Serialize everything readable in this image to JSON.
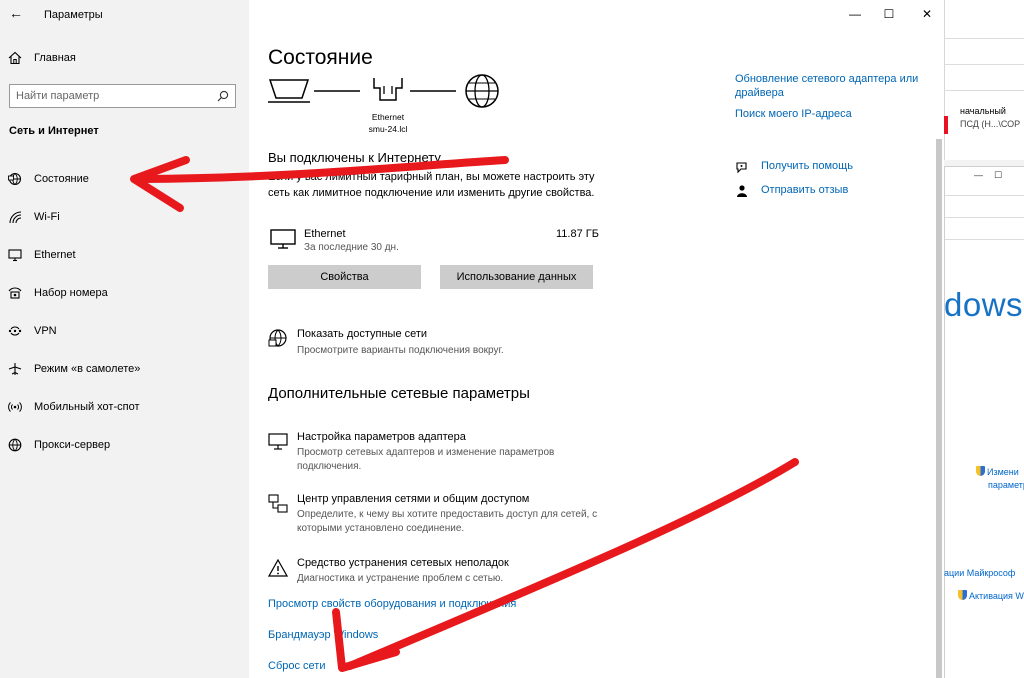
{
  "window": {
    "title": "Параметры",
    "back_glyph": "←",
    "controls": {
      "minimize": "—",
      "maximize": "☐",
      "close": "✕"
    }
  },
  "sidebar": {
    "home_label": "Главная",
    "search_placeholder": "Найти параметр",
    "section_label": "Сеть и Интернет",
    "items": [
      {
        "label": "Состояние",
        "icon": "status-icon"
      },
      {
        "label": "Wi-Fi",
        "icon": "wifi-icon"
      },
      {
        "label": "Ethernet",
        "icon": "ethernet-icon"
      },
      {
        "label": "Набор номера",
        "icon": "dialup-icon"
      },
      {
        "label": "VPN",
        "icon": "vpn-icon"
      },
      {
        "label": "Режим «в самолете»",
        "icon": "airplane-icon"
      },
      {
        "label": "Мобильный хот-спот",
        "icon": "hotspot-icon"
      },
      {
        "label": "Прокси-сервер",
        "icon": "globe-icon"
      }
    ]
  },
  "main": {
    "title": "Состояние",
    "diagram": {
      "adapter_name": "Ethernet",
      "host_name": "smu-24.lcl"
    },
    "connected_title": "Вы подключены к Интернету",
    "connected_desc": "Если у вас лимитный тарифный план, вы можете настроить эту сеть как лимитное подключение или изменить другие свойства.",
    "ethernet": {
      "name": "Ethernet",
      "period": "За последние 30 дн.",
      "usage": "11.87 ГБ"
    },
    "buttons": {
      "properties": "Свойства",
      "data_usage": "Использование данных"
    },
    "show_networks": {
      "title": "Показать доступные сети",
      "desc": "Просмотрите варианты подключения вокруг."
    },
    "advanced_title": "Дополнительные сетевые параметры",
    "advanced": [
      {
        "title": "Настройка параметров адаптера",
        "desc": "Просмотр сетевых адаптеров и изменение параметров подключения.",
        "icon": "adapter-icon"
      },
      {
        "title": "Центр управления сетями и общим доступом",
        "desc": "Определите, к чему вы хотите предоставить доступ для сетей, с которыми установлено соединение.",
        "icon": "network-center-icon"
      },
      {
        "title": "Средство устранения сетевых неполадок",
        "desc": "Диагностика и устранение проблем с сетью.",
        "icon": "warning-icon"
      }
    ],
    "links": {
      "hardware": "Просмотр свойств оборудования и подключения",
      "firewall": "Брандмауэр Windows",
      "reset": "Сброс сети"
    }
  },
  "right_panel": {
    "update_adapter": "Обновление сетевого адаптера или драйвера",
    "update_adapter_line1": "Обновление сетевого адаптера или",
    "update_adapter_line2": "драйвера",
    "find_ip": "Поиск моего IP-адреса",
    "get_help": "Получить помощь",
    "feedback": "Отправить отзыв"
  },
  "background_window": {
    "label1": "начальный",
    "label2": "ПСД (Н...\\СОР",
    "windows_text": "dows",
    "link1_line1": "Измени",
    "link1_line2": "параметры",
    "link2": "ации Майкрософ",
    "link3": "Активация Wi"
  },
  "colors": {
    "accent": "#0066b4",
    "annotation": "#e8191c",
    "sidebar_bg": "#f2f2f2",
    "button_bg": "#cccccc"
  }
}
